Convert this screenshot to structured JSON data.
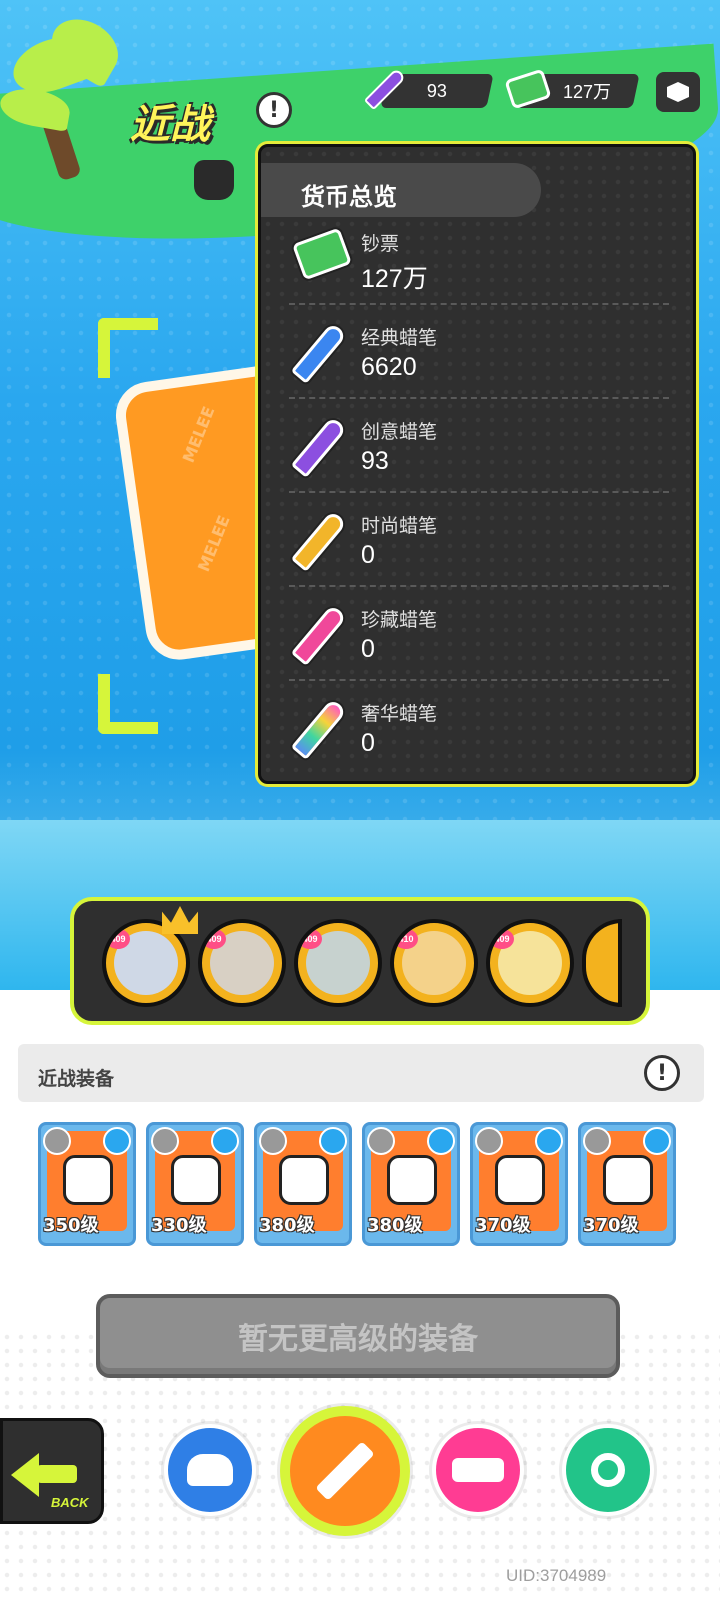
{
  "header": {
    "title": "近战",
    "currencies": [
      {
        "name": "creative-crayon",
        "value": "93"
      },
      {
        "name": "banknote",
        "value": "127万"
      }
    ]
  },
  "popup": {
    "title": "货币总览",
    "items": [
      {
        "name": "钞票",
        "value": "127万",
        "icon": "banknote-icon",
        "color": "#47c45c"
      },
      {
        "name": "经典蜡笔",
        "value": "6620",
        "icon": "crayon-icon",
        "color": "#3b86f0"
      },
      {
        "name": "创意蜡笔",
        "value": "93",
        "icon": "crayon-icon",
        "color": "#8c4fe0"
      },
      {
        "name": "时尚蜡笔",
        "value": "0",
        "icon": "crayon-icon",
        "color": "#f2b52a"
      },
      {
        "name": "珍藏蜡笔",
        "value": "0",
        "icon": "crayon-icon",
        "color": "#f0489a"
      },
      {
        "name": "奢华蜡笔",
        "value": "0",
        "icon": "crayon-icon",
        "color": "#e85bbf"
      }
    ]
  },
  "heroes": [
    {
      "level": "409"
    },
    {
      "level": "409"
    },
    {
      "level": "409"
    },
    {
      "level": "410"
    },
    {
      "level": "409"
    }
  ],
  "equipment": {
    "title": "近战装备",
    "items": [
      {
        "level": "350级"
      },
      {
        "level": "330级"
      },
      {
        "level": "380级"
      },
      {
        "level": "380级"
      },
      {
        "level": "370级"
      },
      {
        "level": "370级"
      }
    ]
  },
  "upgrade_button": "暂无更高级的装备",
  "back_label": "BACK",
  "uid": "UID:3704989",
  "colors": {
    "accent_yellow": "#d6f53a",
    "tab_cannon": "#2f7fe6",
    "tab_melee": "#ff8a1f",
    "tab_gun": "#ff3c93",
    "tab_special": "#22c489"
  }
}
